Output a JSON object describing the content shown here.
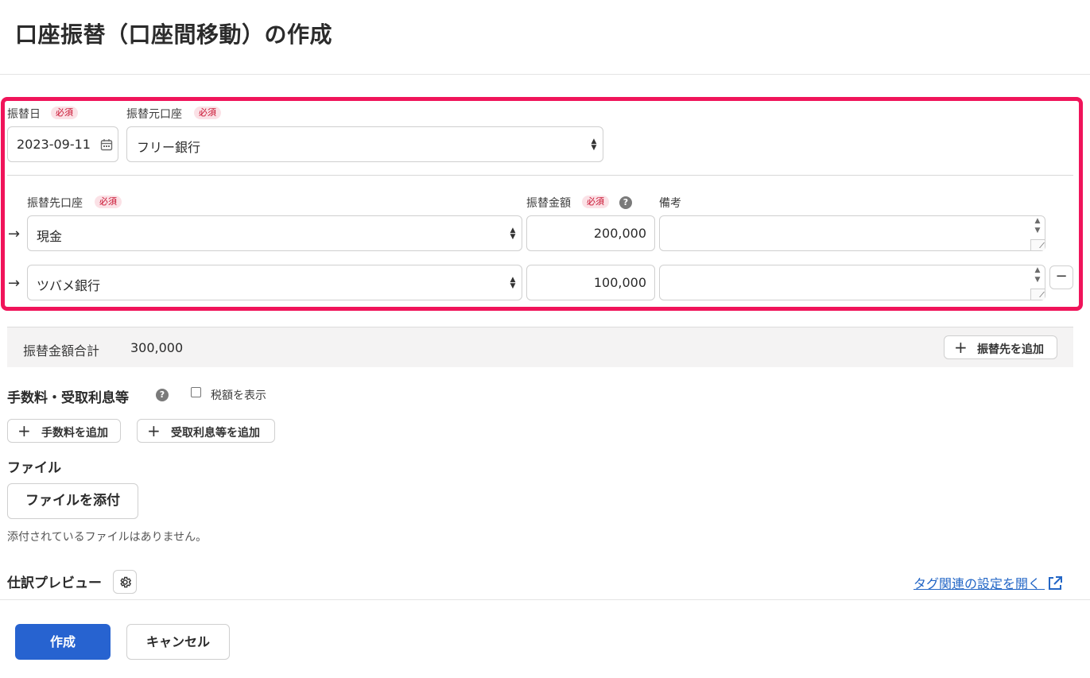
{
  "page": {
    "title": "口座振替（口座間移動）の作成"
  },
  "header_row": {
    "date_label": "振替日",
    "required_badge": "必須",
    "date_value": "2023-09-11",
    "source_label": "振替元口座",
    "source_value": "フリー銀行"
  },
  "columns": {
    "dest_label": "振替先口座",
    "amount_label": "振替金額",
    "memo_label": "備考"
  },
  "rows": [
    {
      "dest": "現金",
      "amount": "200,000",
      "memo": ""
    },
    {
      "dest": "ツバメ銀行",
      "amount": "100,000",
      "memo": ""
    }
  ],
  "total": {
    "label": "振替金額合計",
    "value": "300,000",
    "add_dest_button": "振替先を追加"
  },
  "fees": {
    "heading": "手数料・受取利息等",
    "tax_checkbox_label": "税額を表示",
    "tax_checked": false,
    "add_fee_button": "手数料を追加",
    "add_interest_button": "受取利息等を追加"
  },
  "file": {
    "heading": "ファイル",
    "attach_button": "ファイルを添付",
    "empty_text": "添付されているファイルはありません。"
  },
  "preview": {
    "heading": "仕訳プレビュー",
    "tag_link": "タグ関連の設定を開く"
  },
  "footer": {
    "create_button": "作成",
    "cancel_button": "キャンセル"
  },
  "colors": {
    "highlight": "#f0145a",
    "primary": "#2763d0",
    "link": "#2366c6",
    "required_badge_bg": "#fbe1e6",
    "required_badge_text": "#c8102e"
  },
  "icons": [
    "calendar-icon",
    "help-icon",
    "arrow-right-icon",
    "minus-icon",
    "plus-icon",
    "gear-icon",
    "external-link-icon"
  ]
}
